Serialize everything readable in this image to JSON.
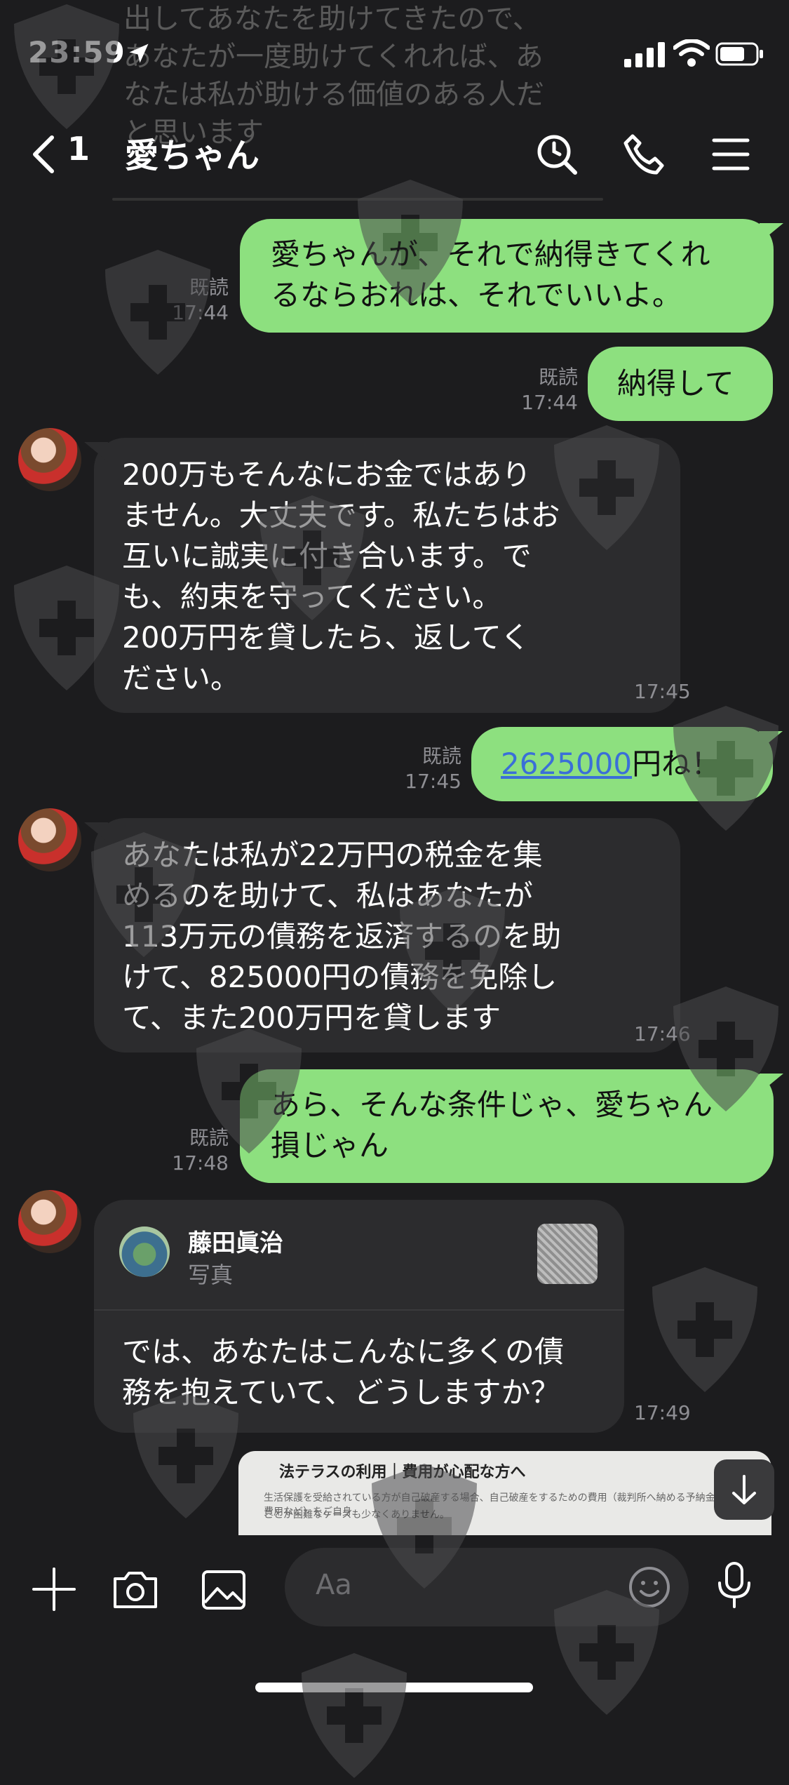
{
  "status_bar": {
    "time": "23:59"
  },
  "header": {
    "unread_count": "1",
    "title": "愛ちゃん"
  },
  "previous_message": {
    "lines": [
      "出してあなたを助けてきたので、",
      "あなたが一度助けてくれれば、あ",
      "なたは私が助ける価値のある人だ",
      "と思います"
    ]
  },
  "messages": [
    {
      "id": "m1",
      "side": "mine",
      "lines": [
        "愛ちゃんが、それで納得きてくれ",
        "るならおれは、それでいいよ。"
      ],
      "read": "既読",
      "time": "17:44"
    },
    {
      "id": "m2",
      "side": "mine",
      "lines": [
        "納得して"
      ],
      "read": "既読",
      "time": "17:44"
    },
    {
      "id": "m3",
      "side": "theirs",
      "lines": [
        "200万もそんなにお金ではあり",
        "ません。大丈夫です。私たちはお",
        "互いに誠実に付き合います。で",
        "も、約束を守ってください。",
        "200万円を貸したら、返してく",
        "ださい。"
      ],
      "time": "17:45"
    },
    {
      "id": "m4",
      "side": "mine",
      "link": "2625000",
      "suffix": "円ね！",
      "read": "既読",
      "time": "17:45"
    },
    {
      "id": "m5",
      "side": "theirs",
      "lines": [
        "あなたは私が22万円の税金を集",
        "めるのを助けて、私はあなたが",
        "113万元の債務を返済するのを助",
        "けて、825000円の債務を免除し",
        "て、また200万円を貸します"
      ],
      "time": "17:46"
    },
    {
      "id": "m6",
      "side": "mine",
      "lines": [
        "あら、そんな条件じゃ、愛ちゃん",
        "損じゃん"
      ],
      "read": "既読",
      "time": "17:48"
    }
  ],
  "reply_card": {
    "quoted_name": "藤田眞治",
    "quoted_type": "写真",
    "lines": [
      "では、あなたはこんなに多くの債",
      "務を抱えていて、どうしますか？"
    ],
    "time": "17:49"
  },
  "image_message": {
    "heading": "法テラスの利用｜費用が心配な方へ",
    "line1": "生活保護を受給されている方が自己破産する場合、自己破産をするための費用（裁判所へ納める予納金や弁護士費用など）をご自身",
    "line2": "ことが困難なケースも少なくありません。"
  },
  "input": {
    "placeholder": "Aa"
  },
  "icons": {
    "back": "chevron-left-icon",
    "search": "search-icon",
    "call": "phone-icon",
    "menu": "menu-icon",
    "plus": "plus-icon",
    "camera": "camera-icon",
    "image": "image-icon",
    "emoji": "emoji-icon",
    "mic": "mic-icon",
    "scroll": "arrow-down-icon",
    "watermark": "shield-plus-icon"
  },
  "colors": {
    "my_bubble": "#8de07f",
    "their_bubble": "#2c2c2e",
    "background": "#1c1c1e",
    "link": "#3a6fd8"
  }
}
